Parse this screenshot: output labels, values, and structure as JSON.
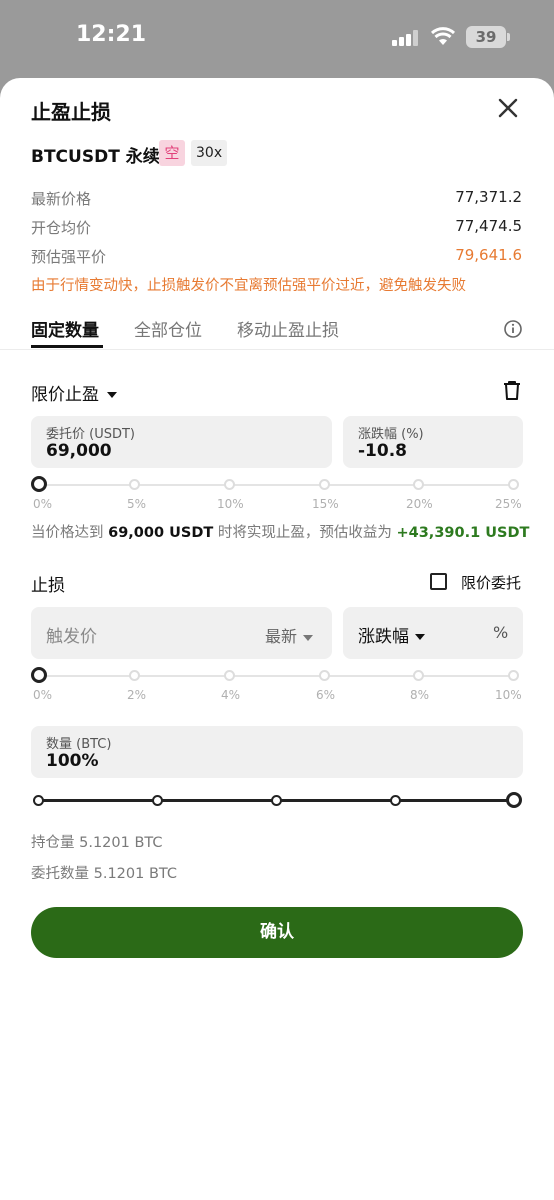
{
  "status": {
    "time": "12:21",
    "battery": "39"
  },
  "header": {
    "title": "止盈止损"
  },
  "contract": {
    "symbol": "BTCUSDT 永续",
    "side": "空",
    "leverage": "30x"
  },
  "prices": [
    {
      "label": "最新价格",
      "value": "77,371.2"
    },
    {
      "label": "开仓均价",
      "value": "77,474.5"
    },
    {
      "label": "预估强平价",
      "value": "79,641.6"
    }
  ],
  "warning": "由于行情变动快，止损触发价不宜离预估强平价过近，避免触发失败",
  "tabs": [
    {
      "label": "固定数量"
    },
    {
      "label": "全部仓位"
    },
    {
      "label": "移动止盈止损"
    }
  ],
  "take_profit": {
    "title": "限价止盈",
    "price_label": "委托价 (USDT)",
    "price_value": "69,000",
    "pct_label": "涨跌幅 (%)",
    "pct_value": "-10.8",
    "ticks": [
      "0%",
      "5%",
      "10%",
      "15%",
      "20%",
      "25%"
    ],
    "slider_value": 0,
    "info_prefix": "当价格达到",
    "info_price": "69,000 USDT",
    "info_mid": "时将实现止盈，预估收益为",
    "info_profit": "+43,390.1 USDT"
  },
  "stop_loss": {
    "title": "止损",
    "limit_label": "限价委托",
    "trigger_placeholder": "触发价",
    "trigger_type": "最新",
    "pct_select": "涨跌幅",
    "pct_unit": "%",
    "ticks": [
      "0%",
      "2%",
      "4%",
      "6%",
      "8%",
      "10%"
    ],
    "slider_value": 0
  },
  "quantity": {
    "label": "数量 (BTC)",
    "value": "100%",
    "slider_value": 100,
    "position": "持仓量 5.1201 BTC",
    "order_qty": "委托数量 5.1201 BTC"
  },
  "confirm_label": "确认",
  "colors": {
    "accent": "#2b6a17",
    "warning": "#e77a32",
    "short": "#e2407a",
    "profit": "#2d7a1f"
  }
}
